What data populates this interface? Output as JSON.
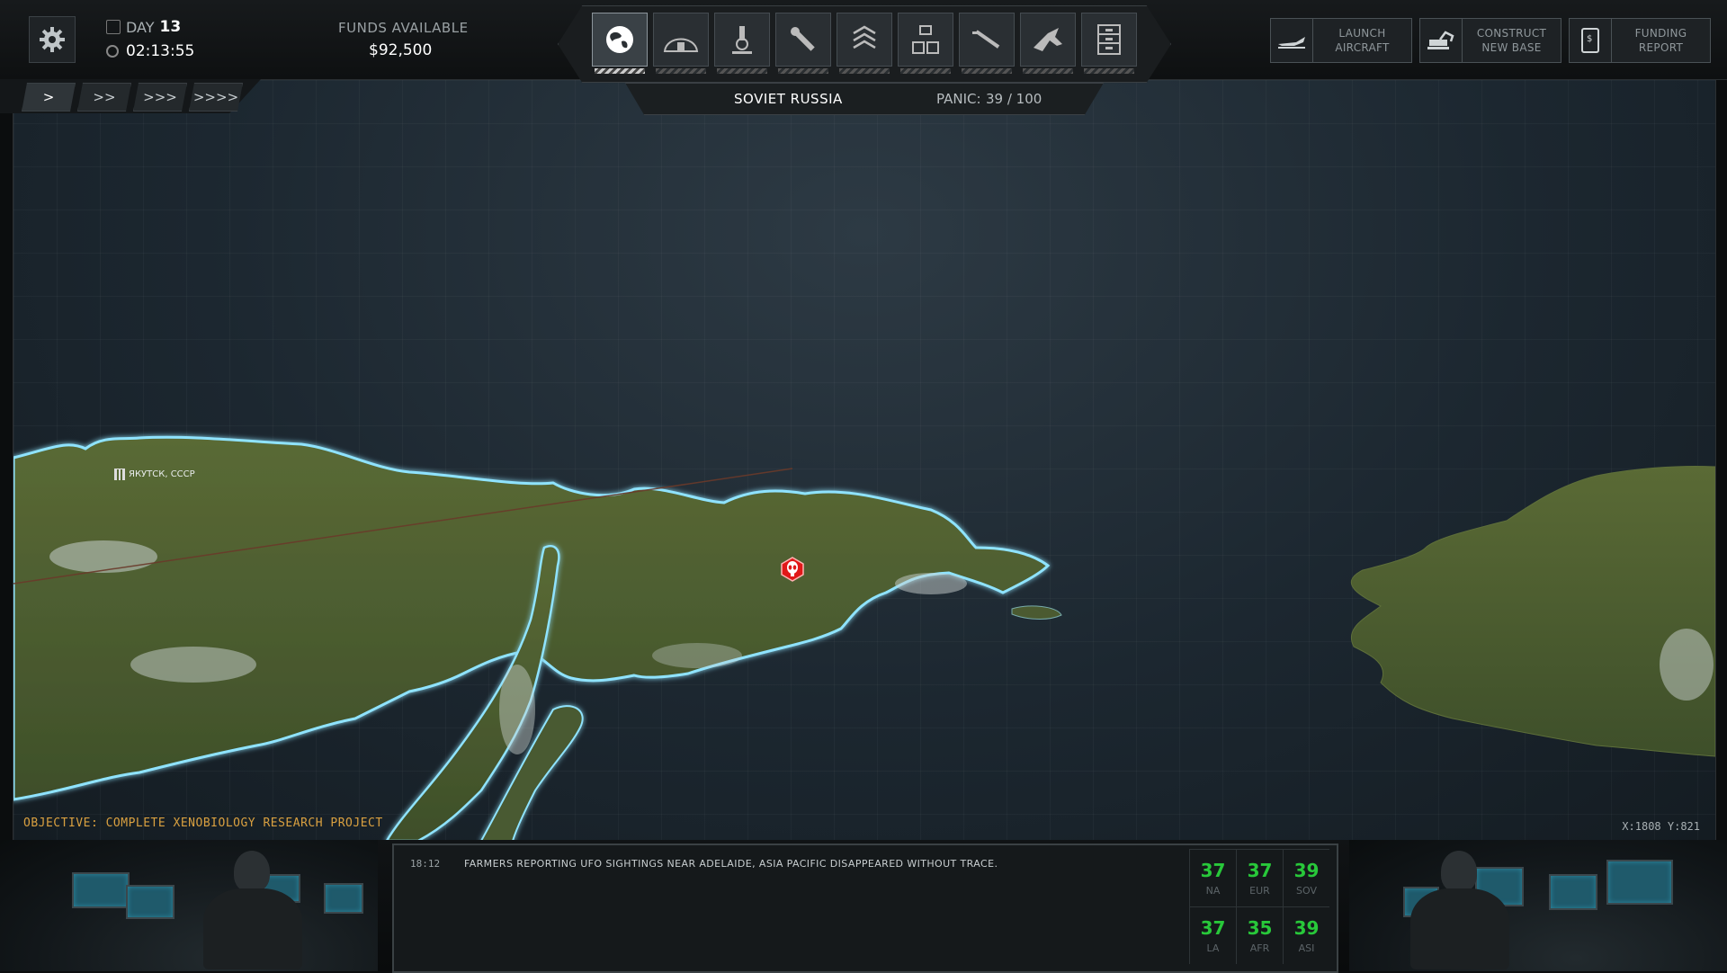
{
  "header": {
    "day_label": "DAY",
    "day_value": "13",
    "time": "02:13:55",
    "funds_label": "FUNDS AVAILABLE",
    "funds_value": "$92,500"
  },
  "speed": [
    ">",
    ">>",
    ">>>",
    ">>>>"
  ],
  "nav": [
    "globe-icon",
    "base-icon",
    "research-icon",
    "engineering-icon",
    "barracks-icon",
    "situation-room-icon",
    "hangar-icon",
    "aircraft-icon",
    "archives-icon"
  ],
  "region": {
    "name": "SOVIET RUSSIA",
    "panic_label": "PANIC:",
    "panic_value": "39 / 100"
  },
  "actions": [
    {
      "label_1": "LAUNCH",
      "label_2": "AIRCRAFT"
    },
    {
      "label_1": "CONSTRUCT",
      "label_2": "NEW BASE"
    },
    {
      "label_1": "FUNDING",
      "label_2": "REPORT"
    }
  ],
  "map": {
    "city": "ЯКУТСК, СССР",
    "objective": "OBJECTIVE: COMPLETE XENOBIOLOGY RESEARCH PROJECT",
    "coords": "X:1808 Y:821"
  },
  "ticker": {
    "time": "18:12",
    "message": "FARMERS REPORTING UFO SIGHTINGS NEAR ADELAIDE, ASIA PACIFIC DISAPPEARED WITHOUT TRACE."
  },
  "panic_grid": [
    {
      "value": "37",
      "label": "NA"
    },
    {
      "value": "37",
      "label": "EUR"
    },
    {
      "value": "39",
      "label": "SOV"
    },
    {
      "value": "37",
      "label": "LA"
    },
    {
      "value": "35",
      "label": "AFR"
    },
    {
      "value": "39",
      "label": "ASI"
    }
  ],
  "colors": {
    "panic_green": "#28c83a",
    "coast_glow": "#7fd9ff",
    "objective": "#d9a040",
    "alert_red": "#e01818"
  }
}
